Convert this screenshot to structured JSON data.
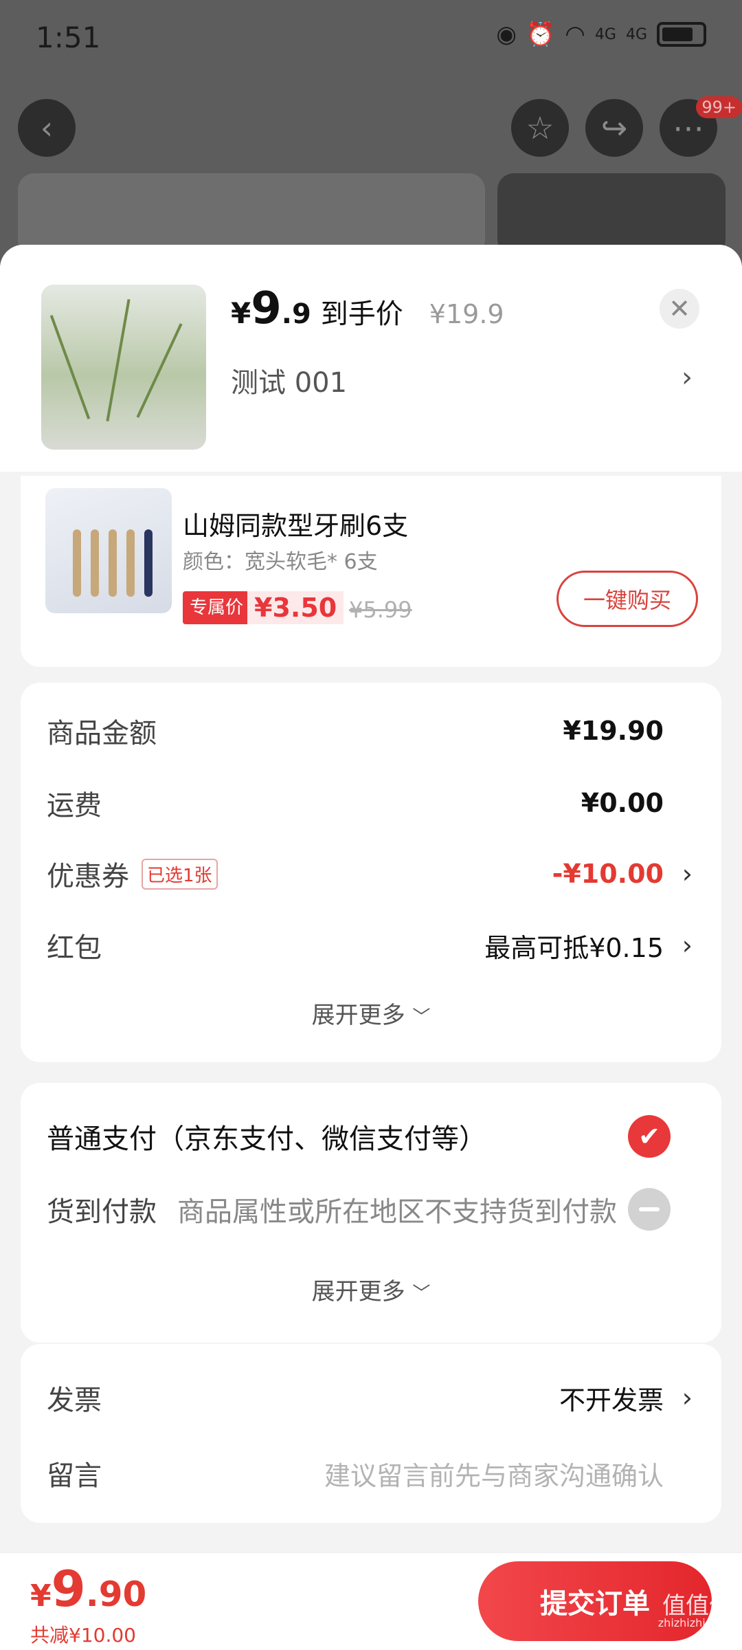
{
  "status_bar": {
    "time": "1:51",
    "network_1": "4G",
    "network_2": "4G"
  },
  "background": {
    "more_badge": "99+"
  },
  "header": {
    "price_currency": "¥",
    "price_integer": "9",
    "price_decimal": ".9",
    "price_label": "到手价",
    "original_price": "¥19.9",
    "variant": "测试  001"
  },
  "recommend": {
    "title": "山姆同款型牙刷6支",
    "spec": "颜色：宽头软毛* 6支",
    "tag": "专属价",
    "price": "¥3.50",
    "original_price": "¥5.99",
    "buy_label": "一键购买"
  },
  "fees": {
    "items": [
      {
        "label": "商品金额",
        "value": "¥19.90"
      },
      {
        "label": "运费",
        "value": "¥0.00"
      },
      {
        "label": "优惠券",
        "tag": "已选1张",
        "value": "-¥10.00"
      },
      {
        "label": "红包",
        "value": "最高可抵¥0.15"
      }
    ],
    "expand_label": "展开更多"
  },
  "payment": {
    "normal": "普通支付（京东支付、微信支付等）",
    "cod_label": "货到付款",
    "cod_note": "商品属性或所在地区不支持货到付款",
    "expand_label": "展开更多"
  },
  "invoice": {
    "invoice_label": "发票",
    "invoice_value": "不开发票",
    "message_label": "留言",
    "message_placeholder": "建议留言前先与商家沟通确认"
  },
  "bottom": {
    "currency": "¥",
    "total_integer": "9",
    "total_decimal": ".90",
    "saved": "共减¥10.00",
    "submit_label": "提交订单",
    "watermark": "值值值",
    "watermark_url": "zhizhizhi.com"
  },
  "colors": {
    "accent": "#e33a32",
    "overlay": "#5d5d5d"
  }
}
